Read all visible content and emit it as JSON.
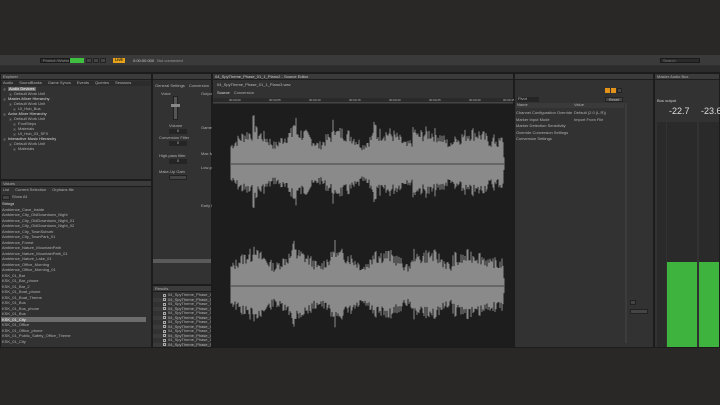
{
  "toolbar": {
    "search_placeholder": "Project (Wwise)",
    "live_label": "LIVE",
    "time": "0:00:00.000",
    "status": "Not connected",
    "search2": "Search"
  },
  "left": {
    "title": "Explorer",
    "tabs": [
      "Audio",
      "SoundBanks",
      "Game Syncs",
      "Events",
      "Queries",
      "Sessions"
    ],
    "tree": [
      "Audio Devices",
      "Default Work Unit",
      "Master-Mixer Hierarchy",
      "Default Work Unit",
      "UI_Hub_Bus",
      "Actor-Mixer Hierarchy",
      "Default Work Unit",
      "FootSteps",
      "Materials",
      "UI_Hub_03_SFX",
      "Interactive Music Hierarchy",
      "Default Work Unit",
      "Materials"
    ],
    "list_title": "Values",
    "list_tabs": [
      "List",
      "Current Selection",
      "Orphans file"
    ],
    "show_all": "Show All",
    "list_header": "Strings",
    "list_items": [
      "Ambience_Cave_Inside",
      "Ambience_City_OldDowntown_Night",
      "Ambience_City_OldDowntown_Night_01",
      "Ambience_City_OldDowntown_Night_02",
      "Ambience_City_TownSuburb",
      "Ambience_City_TownPark_01",
      "Ambience_Forest",
      "Ambience_Nature_MountainPath",
      "Ambience_Nature_MountainPath_01",
      "Ambience_Nature_Lake_01",
      "Ambience_Office_Morning",
      "Ambience_Office_Morning_01",
      "KSK_01_Bar",
      "KSK_01_Bar_phone",
      "KSK_01_Bar_2",
      "KSK_01_Boat_phone",
      "KSK_01_Boat_Theme",
      "KSK_01_Bus",
      "KSK_01_Bus_phone",
      "KSK_01_Bus",
      "KSK_01_City",
      "KSK_01_Office",
      "KSK_01_Office_phone",
      "KSK_01_Public_Safety_Office_Theme",
      "KSK_01_City"
    ],
    "selected_index": 20
  },
  "center": {
    "tab_title": "04_SpyTheme_Phase_01_1_Piano",
    "general": "General Settings",
    "conversion": "Conversion",
    "labels": [
      "Voice",
      "Output Bus",
      "Volume",
      "Game Defined",
      "Conversion Filter",
      "Max Mem",
      "High-pass filter",
      "Low-pass",
      "Make-Up Gain",
      "Early Reflect"
    ],
    "values": [
      "0",
      "0",
      "0"
    ],
    "results_title": "Results",
    "results": [
      "04_SpyTheme_Phase_01",
      "04_SpyTheme_Phase_01",
      "04_SpyTheme_Phase_01",
      "04_SpyTheme_Phase_01",
      "04_SpyTheme_Phase_01",
      "04_SpyTheme_Phase_01",
      "04_SpyTheme_Phase_01",
      "04_SpyTheme_Phase_01",
      "04_SpyTheme_Phase_01",
      "04_SpyTheme_Phase_01",
      "04_SpyTheme_Phase_01",
      "04_SpyTheme_Phase_01"
    ]
  },
  "editor": {
    "tab": "04_SpyTheme_Phase_01_1_Piano2 - Source Editor",
    "file_label": "04_SpyTheme_Phase_01_1_Piano3.wav",
    "tabs": [
      "Source",
      "Conversion"
    ],
    "times": [
      "00:00:00",
      "00:00:05",
      "00:00:10",
      "00:00:15",
      "00:00:20",
      "00:00:25",
      "00:00:30",
      "00:00:35"
    ]
  },
  "props": {
    "filter": "Pivot",
    "reset": "Reset",
    "col_name": "Name",
    "col_value": "Value",
    "rows": [
      [
        "Channel Configuration Override",
        "Default (2.0 (L,R))"
      ],
      [
        "Marker Input Mode",
        "Import From File"
      ],
      [
        "Marker Detection Sensitivity",
        ""
      ],
      [
        "Override Conversion Settings",
        ""
      ],
      [
        "Conversion Settings",
        ""
      ]
    ]
  },
  "meter": {
    "title": "Master Audio Bus",
    "subtitle": "Bus output",
    "left_value": "-22.7",
    "right_value": "-23.6"
  },
  "colors": {
    "accent": "#e7a218",
    "meter": "#3eb43e"
  }
}
